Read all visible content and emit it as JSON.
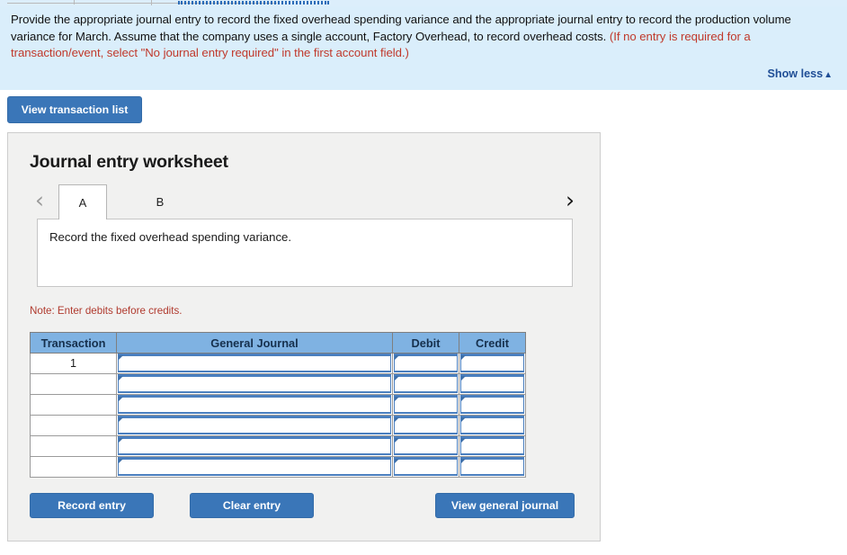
{
  "banner": {
    "text_black": "Provide the appropriate journal entry to record the fixed overhead spending variance and the appropriate journal entry to record the production volume variance for March. Assume that the company uses a single account, Factory Overhead, to record overhead costs. ",
    "text_red": "(If no entry is required for a transaction/event, select \"No journal entry required\" in the first account field.)",
    "show_less_label": "Show less",
    "show_less_icon": "triangle-up-icon",
    "background_color": "#daeefb",
    "red_color": "#c0392b",
    "link_color": "#1f4e96"
  },
  "toolbar": {
    "view_transaction_list_label": "View transaction list"
  },
  "panel": {
    "title": "Journal entry worksheet",
    "background_color": "#f1f1f0"
  },
  "tabs": {
    "prev_icon": "chevron-left-icon",
    "next_icon": "chevron-right-icon",
    "prev_enabled": false,
    "next_enabled": true,
    "items": [
      {
        "label": "A",
        "active": true
      },
      {
        "label": "B",
        "active": false
      }
    ]
  },
  "description": {
    "text": "Record the fixed overhead spending variance."
  },
  "note": {
    "text": "Note: Enter debits before credits."
  },
  "table": {
    "headers": [
      "Transaction",
      "General Journal",
      "Debit",
      "Credit"
    ],
    "header_color": "#7fb2e2",
    "rows": [
      {
        "transaction": "1",
        "general_journal": "",
        "debit": "",
        "credit": ""
      },
      {
        "transaction": "",
        "general_journal": "",
        "debit": "",
        "credit": ""
      },
      {
        "transaction": "",
        "general_journal": "",
        "debit": "",
        "credit": ""
      },
      {
        "transaction": "",
        "general_journal": "",
        "debit": "",
        "credit": ""
      },
      {
        "transaction": "",
        "general_journal": "",
        "debit": "",
        "credit": ""
      },
      {
        "transaction": "",
        "general_journal": "",
        "debit": "",
        "credit": ""
      }
    ]
  },
  "footer": {
    "record_entry_label": "Record entry",
    "clear_entry_label": "Clear entry",
    "view_general_journal_label": "View general journal",
    "button_color": "#3a76b8"
  }
}
